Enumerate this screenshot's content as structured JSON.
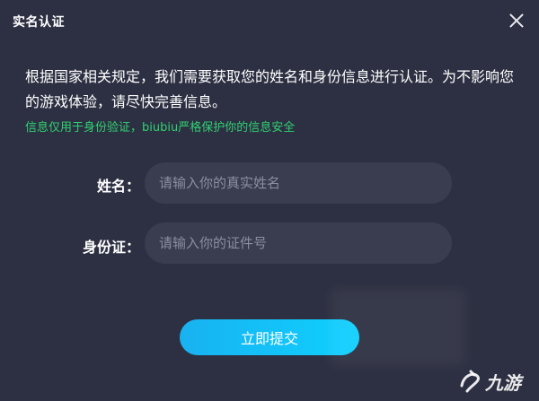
{
  "dialog": {
    "title": "实名认证",
    "close_icon": "close-icon"
  },
  "description": "根据国家相关规定，我们需要获取您的姓名和身份信息进行认证。为不影响您的游戏体验，请尽快完善信息。",
  "notice": "信息仅用于身份验证，biubiu严格保护你的信息安全",
  "form": {
    "name_label": "姓名：",
    "name_placeholder": "请输入你的真实姓名",
    "id_label": "身份证：",
    "id_placeholder": "请输入你的证件号"
  },
  "submit_label": "立即提交",
  "watermark": "九游",
  "colors": {
    "background": "#2d3042",
    "input_bg": "#3a3d50",
    "notice": "#2fd171",
    "button_start": "#18b2f0",
    "button_end": "#0fd0ff"
  }
}
